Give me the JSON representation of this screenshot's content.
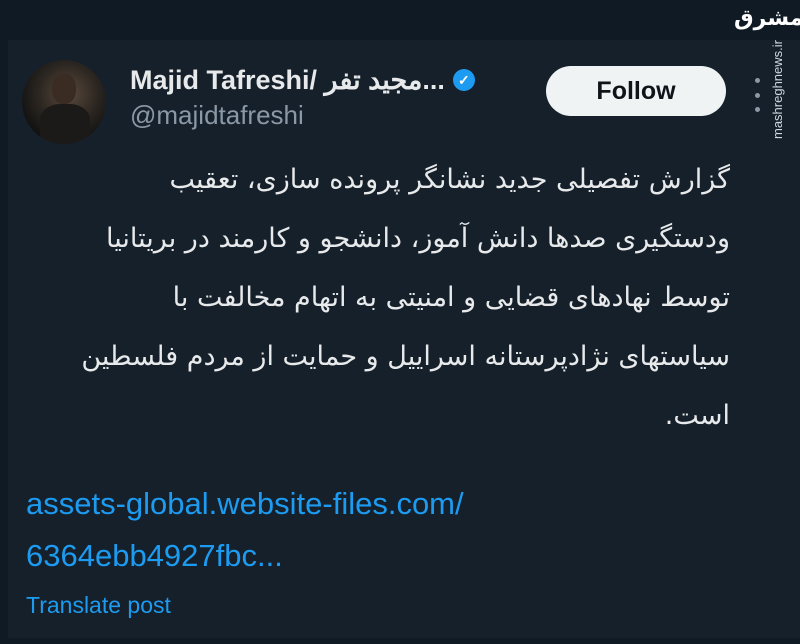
{
  "watermark": {
    "logo_text": "مشرق",
    "url": "mashreghnews.ir"
  },
  "author": {
    "display_name": "Majid Tafreshi/ مجید تفر...",
    "handle": "@majidtafreshi",
    "verified_icon": "check-badge-icon"
  },
  "actions": {
    "follow_label": "Follow",
    "more_icon": "vertical-ellipsis-icon"
  },
  "tweet": {
    "lines": [
      "گزارش تفصیلی جدید نشانگر پرونده سازی، تعقیب",
      "ودستگیری صدها دانش آموز، دانشجو و کارمند در بریتانیا",
      "توسط نهادهای قضایی و امنیتی به اتهام مخالفت با",
      "سیاستهای نژادپرستانه اسراییل و حمایت از مردم فلسطین",
      "است."
    ],
    "link_line1": "assets-global.website-files.com/",
    "link_line2": "6364ebb4927fbc...",
    "translate_label": "Translate post"
  },
  "colors": {
    "background": "#15202b",
    "text": "#e7e9ea",
    "secondary": "#8b98a5",
    "accent": "#1d9bf0"
  }
}
